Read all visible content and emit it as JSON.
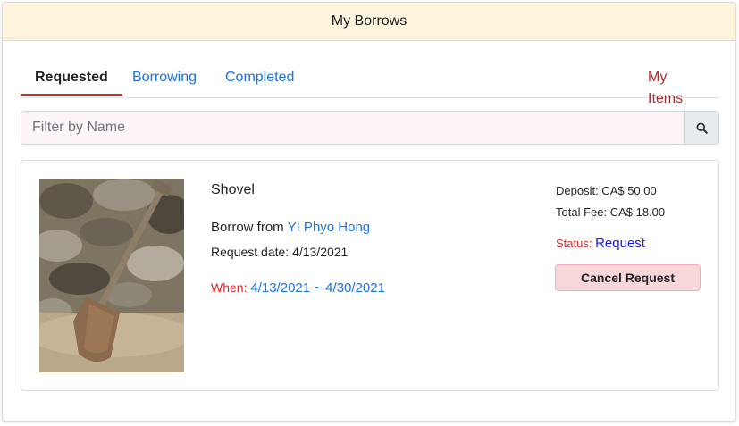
{
  "header": {
    "title": "My Borrows"
  },
  "tabs": [
    {
      "label": "Requested"
    },
    {
      "label": "Borrowing"
    },
    {
      "label": "Completed"
    }
  ],
  "my_items_tab": {
    "label": "My Items"
  },
  "filter": {
    "placeholder": "Filter by Name",
    "value": ""
  },
  "item": {
    "name": "Shovel",
    "borrow_from_label": "Borrow from",
    "lender": "YI Phyo Hong",
    "request_date_label": "Request date:",
    "request_date": "4/13/2021",
    "when_label": "When:",
    "when_value": "4/13/2021 ~ 4/30/2021",
    "deposit": "Deposit: CA$ 50.00",
    "total_fee": "Total Fee: CA$ 18.00",
    "status_label": "Status:",
    "status_value": "Request",
    "cancel_label": "Cancel Request"
  },
  "icons": {
    "search": "search-icon"
  },
  "colors": {
    "accent": "#c9302c",
    "link": "#1a73e8",
    "header_bg": "#fdf4dd"
  }
}
